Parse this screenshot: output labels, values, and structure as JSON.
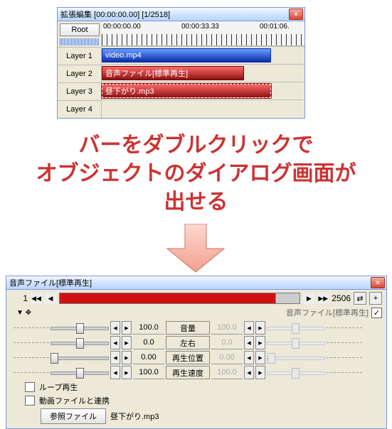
{
  "timeline_window": {
    "title": "拡張編集 [00:00:00.00] [1/2518]",
    "root": "Root",
    "layers": [
      "Layer 1",
      "Layer 2",
      "Layer 3",
      "Layer 4"
    ],
    "ruler": [
      "00:00:00.00",
      "00:00:33.33",
      "00:01:06."
    ],
    "clips": {
      "video": "video.mp4",
      "audio1": "音声ファイル[標準再生]",
      "audio2": "昼下がり.mp3"
    }
  },
  "annotation": {
    "line1": "バーをダブルクリックで",
    "line2": "オブジェクトのダイアログ画面が",
    "line3": "出せる"
  },
  "object_window": {
    "title": "音声ファイル[標準再生]",
    "frame_start": "1",
    "frame_end": "2506",
    "header_label": "音声ファイル[標準再生]",
    "params": [
      {
        "name": "音量",
        "val_l": "100.0",
        "val_r": "100.0"
      },
      {
        "name": "左右",
        "val_l": "0.0",
        "val_r": "0.0"
      },
      {
        "name": "再生位置",
        "val_l": "0.00",
        "val_r": "0.00"
      },
      {
        "name": "再生速度",
        "val_l": "100.0",
        "val_r": "100.0"
      }
    ],
    "checkboxes": {
      "loop": "ループ再生",
      "link": "動画ファイルと連携"
    },
    "ref_btn": "参照ファイル",
    "ref_file": "昼下がり.mp3"
  }
}
